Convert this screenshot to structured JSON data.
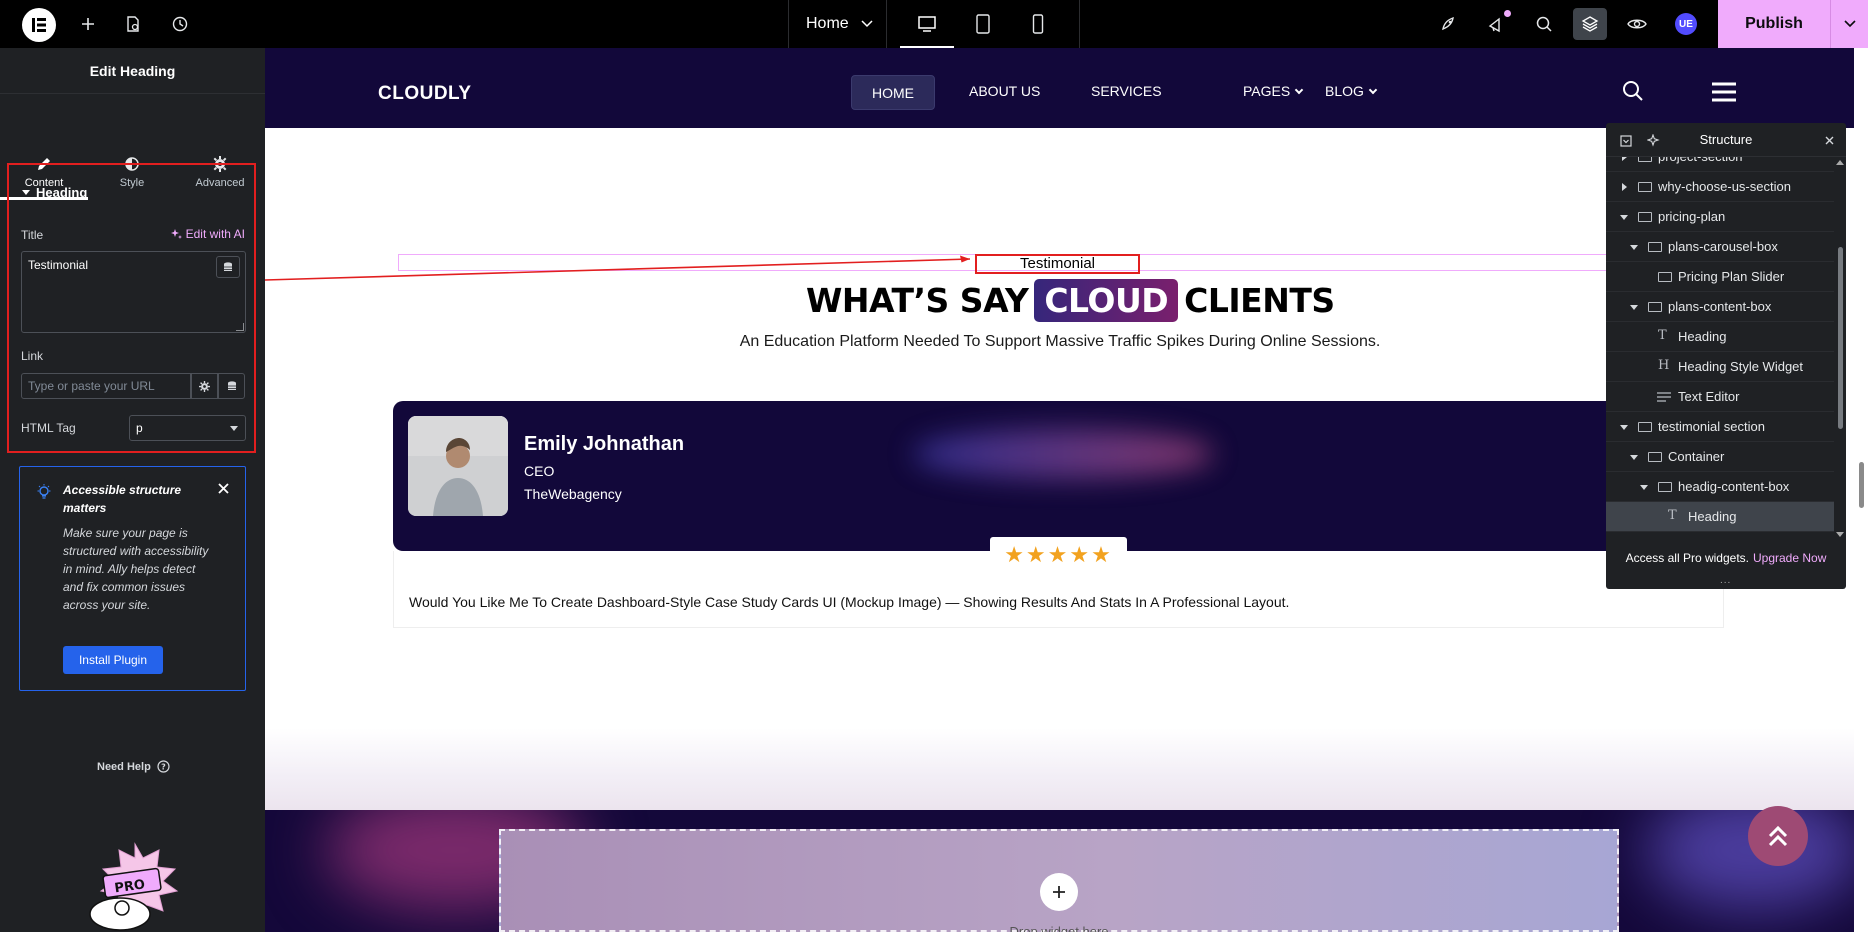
{
  "topbar": {
    "page_selector": "Home",
    "publish_label": "Publish",
    "user_initials": "UE",
    "colors": {
      "background": "#000000",
      "publish": "#f0abfc"
    },
    "icons": [
      "elementor-logo-icon",
      "add-icon",
      "page-settings-icon",
      "history-icon",
      "desktop-icon",
      "tablet-icon",
      "mobile-icon",
      "rocket-icon",
      "notifications-icon",
      "search-icon",
      "structure-icon",
      "preview-icon"
    ]
  },
  "panel": {
    "title": "Edit Heading",
    "tabs": [
      {
        "label": "Content",
        "icon": "pencil-icon"
      },
      {
        "label": "Style",
        "icon": "half-circle-icon"
      },
      {
        "label": "Advanced",
        "icon": "gear-icon"
      }
    ],
    "section_title": "Heading",
    "title_label": "Title",
    "edit_ai_label": "Edit with AI",
    "title_value": "Testimonial",
    "link_label": "Link",
    "link_placeholder": "Type or paste your URL",
    "html_tag_label": "HTML Tag",
    "html_tag_value": "p",
    "notice": {
      "title": "Accessible structure matters",
      "text": "Make sure your page is structured with accessibility in mind. Ally helps detect and fix common issues across your site.",
      "button": "Install Plugin"
    },
    "need_help": "Need Help",
    "pro_badge": "PRO"
  },
  "site": {
    "logo": "CLOUDLY",
    "nav": [
      "HOME",
      "ABOUT US",
      "SERVICES",
      "PAGES",
      "BLOG"
    ],
    "testimonial_label": "Testimonial",
    "heading_before": "WHAT’S SAY",
    "heading_highlight": "CLOUD",
    "heading_after": "CLIENTS",
    "subheading": "An Education Platform Needed To Support Massive Traffic Spikes During Online Sessions.",
    "card": {
      "name": "Emily Johnathan",
      "role": "CEO",
      "company": "TheWebagency",
      "rating": 5,
      "stars": "★★★★★",
      "review": "Would You Like Me To Create Dashboard-Style Case Study Cards UI (Mockup Image) — Showing Results And Stats In A Professional Layout."
    },
    "drop_zone_text": "Drop widget here",
    "colors": {
      "nav_bg": "#12083a",
      "star": "#f2a21f",
      "scroll_top": "#9e4a74"
    }
  },
  "structure": {
    "title": "Structure",
    "items": [
      {
        "label": "project-section",
        "level": 0,
        "type": "container",
        "expander": "right"
      },
      {
        "label": "why-choose-us-section",
        "level": 0,
        "type": "container",
        "expander": "right"
      },
      {
        "label": "pricing-plan",
        "level": 0,
        "type": "container",
        "expander": "down"
      },
      {
        "label": "plans-carousel-box",
        "level": 1,
        "type": "container",
        "expander": "down"
      },
      {
        "label": "Pricing Plan Slider",
        "level": 2,
        "type": "container",
        "expander": "none"
      },
      {
        "label": "plans-content-box",
        "level": 1,
        "type": "container",
        "expander": "down"
      },
      {
        "label": "Heading",
        "level": 2,
        "type": "heading",
        "expander": "none"
      },
      {
        "label": "Heading Style Widget",
        "level": 2,
        "type": "heading-style",
        "expander": "none"
      },
      {
        "label": "Text Editor",
        "level": 2,
        "type": "text",
        "expander": "none"
      },
      {
        "label": "testimonial section",
        "level": 0,
        "type": "container",
        "expander": "down"
      },
      {
        "label": "Container",
        "level": 1,
        "type": "container",
        "expander": "down"
      },
      {
        "label": "headig-content-box",
        "level": 2,
        "type": "container",
        "expander": "down"
      },
      {
        "label": "Heading",
        "level": 3,
        "type": "heading",
        "expander": "none",
        "selected": true
      }
    ],
    "footer_text": "Access all Pro widgets.",
    "footer_link": "Upgrade Now",
    "more": "..."
  }
}
